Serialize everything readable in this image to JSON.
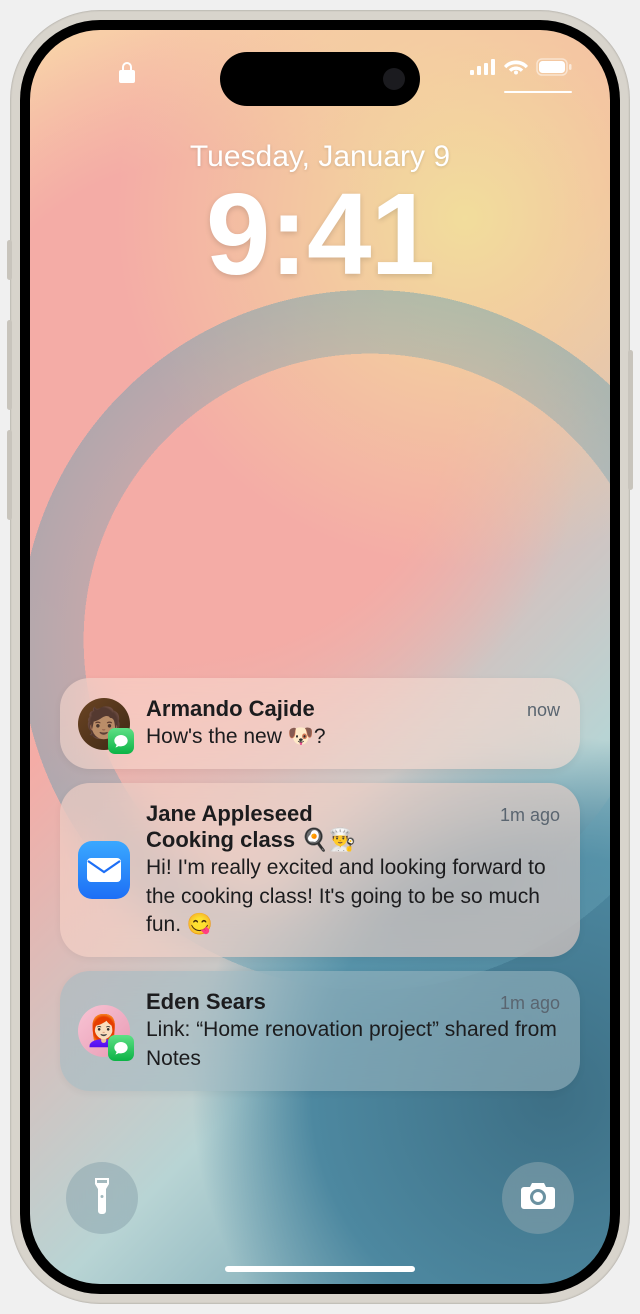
{
  "status": {
    "carrier_bars": 4,
    "wifi": true,
    "battery": true
  },
  "date": "Tuesday, January 9",
  "time": "9:41",
  "notifications": [
    {
      "sender": "Armando Cajide",
      "message": "How's the new 🐶?",
      "time": "now",
      "app": "messages"
    },
    {
      "sender": "Jane Appleseed",
      "subject": "Cooking class 🍳👨‍🍳",
      "message": "Hi! I'm really excited and looking forward to the cooking class! It's going to be so much fun. 😋",
      "time": "1m ago",
      "app": "mail"
    },
    {
      "sender": "Eden Sears",
      "message": "Link: “Home renovation project” shared from Notes",
      "time": "1m ago",
      "app": "messages"
    }
  ],
  "actions": {
    "flashlight": "flashlight",
    "camera": "camera"
  }
}
